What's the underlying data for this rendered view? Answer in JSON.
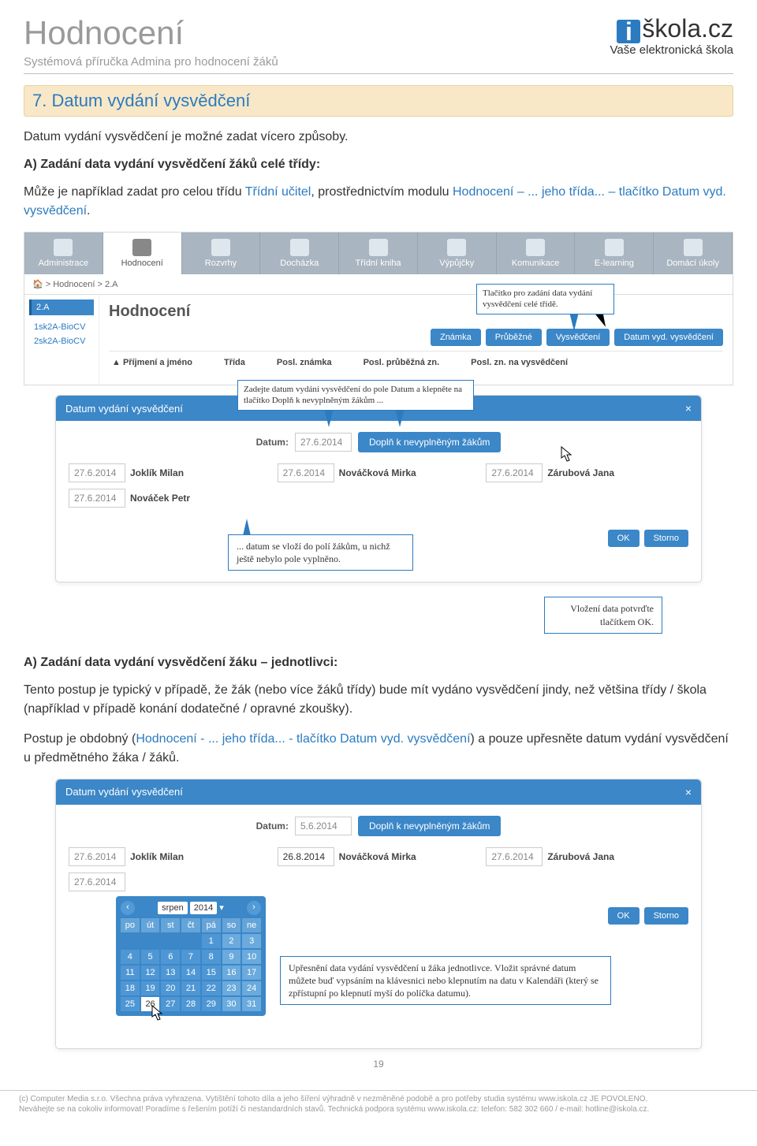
{
  "header": {
    "title": "Hodnocení",
    "subtitle": "Systémová příručka Admina pro hodnocení žáků",
    "brand_i": "i",
    "brand": "škola.cz",
    "brand_tag": "Vaše elektronická škola"
  },
  "section": {
    "title": "7. Datum vydání vysvědčení"
  },
  "p1": "Datum vydání vysvědčení je možné zadat vícero způsoby.",
  "sh1": "A) Zadání data vydání vysvědčení žáků celé třídy:",
  "p2a": "Může je například zadat pro celou třídu ",
  "p2b": "Třídní učitel",
  "p2c": ", prostřednictvím modulu ",
  "p2d": "Hodnocení – ... jeho třída... – tlačítko Datum vyd. vysvědčení",
  "p2e": ".",
  "ss1": {
    "toolbar": [
      "Administrace",
      "Hodnocení",
      "Rozvrhy",
      "Docházka",
      "Třídní kniha",
      "Výpůjčky",
      "Komunikace",
      "E-learning",
      "Domácí úkoly"
    ],
    "crumbs": "🏠 > Hodnocení > 2.A",
    "side_sel": "2.A",
    "side_l1": "1sk2A-BioCV",
    "side_l2": "2sk2A-BioCV",
    "heading": "Hodnocení",
    "callout": "Tlačítko pro zadání data vydání vysvědčení celé třídě.",
    "btns": [
      "Známka",
      "Průběžné",
      "Vysvědčení",
      "Datum vyd. vysvědčení"
    ],
    "cols": [
      "▲ Příjmení a jméno",
      "Třída",
      "Posl. známka",
      "Posl. průběžná zn.",
      "Posl. zn. na vysvědčení"
    ]
  },
  "modal1": {
    "title": "Datum vydání vysvědčení",
    "close": "×",
    "callout_top": "Zadejte datum vydání vysvědčení do pole Datum a klepněte na tlačítko Doplň k nevyplněným žákům ...",
    "datum_label": "Datum:",
    "datum": "27.6.2014",
    "fill_btn": "Doplň k nevyplněným žákům",
    "students": [
      {
        "date": "27.6.2014",
        "name": "Joklík Milan"
      },
      {
        "date": "27.6.2014",
        "name": "Nováčková Mirka"
      },
      {
        "date": "27.6.2014",
        "name": "Zárubová Jana"
      },
      {
        "date": "27.6.2014",
        "name": "Nováček Petr"
      }
    ],
    "callout_mid": "... datum se vloží do polí žákům, u nichž ještě nebylo pole vyplněno.",
    "ok": "OK",
    "storno": "Storno"
  },
  "callout_confirm": "Vložení data potvrďte tlačítkem OK.",
  "sh2": "A) Zadání data vydání vysvědčení žáku – jednotlivci:",
  "p3": "Tento postup je typický v případě, že žák (nebo více žáků třídy) bude mít vydáno vysvědčení jindy, než většina třídy / škola (například v případě konání dodatečné / opravné zkoušky).",
  "p4a": "Postup je obdobný (",
  "p4b": "Hodnocení - ... jeho třída... - tlačítko Datum vyd. vysvědčení",
  "p4c": ") a pouze upřesněte datum vydání vysvědčení u předmětného žáka / žáků.",
  "modal2": {
    "title": "Datum vydání vysvědčení",
    "close": "×",
    "datum_label": "Datum:",
    "datum": "5.6.2014",
    "fill_btn": "Doplň k nevyplněným žákům",
    "students": [
      {
        "date": "27.6.2014",
        "name": "Joklík Milan"
      },
      {
        "date": "26.8.2014",
        "name": "Nováčková Mirka"
      },
      {
        "date": "27.6.2014",
        "name": "Zárubová Jana"
      },
      {
        "date": "27.6.2014",
        "name": ""
      }
    ],
    "ok": "OK",
    "storno": "Storno",
    "cal": {
      "month": "srpen",
      "year": "2014",
      "dh": [
        "po",
        "út",
        "st",
        "čt",
        "pá",
        "so",
        "ne"
      ],
      "rows": [
        [
          "",
          "",
          "",
          "",
          "1",
          "2",
          "3"
        ],
        [
          "4",
          "5",
          "6",
          "7",
          "8",
          "9",
          "10"
        ],
        [
          "11",
          "12",
          "13",
          "14",
          "15",
          "16",
          "17"
        ],
        [
          "18",
          "19",
          "20",
          "21",
          "22",
          "23",
          "24"
        ],
        [
          "25",
          "26",
          "27",
          "28",
          "29",
          "30",
          "31"
        ]
      ],
      "selected": "26"
    },
    "callout": "Upřesnění data vydání vysvědčení u žáka jednotlivce. Vložit správné datum můžete buď vypsáním na klávesnici nebo klepnutím na datu v Kalendáři (který se zpřístupní po klepnutí myší do políčka datumu)."
  },
  "page_no": "19",
  "footer_l1": "(c) Computer Media s.r.o. Všechna práva vyhrazena. Vytištění tohoto díla a jeho šíření výhradně v nezměněné podobě a pro potřeby studia systému www.iskola.cz JE POVOLENO.",
  "footer_l2": "Neváhejte se na cokoliv informovat! Poradíme s řešením potíží či nestandardních stavů. Technická podpora systému www.iskola.cz: telefon: 582 302 660 / e-mail: hotline@iskola.cz."
}
